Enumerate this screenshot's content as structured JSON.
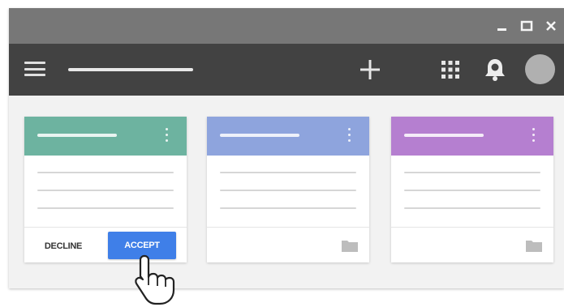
{
  "window": {
    "controls": [
      "minimize-icon",
      "maximize-icon",
      "close-icon"
    ]
  },
  "appbar": {
    "menu_icon": "hamburger-menu-icon",
    "add_icon": "plus-icon",
    "apps_icon": "apps-grid-icon",
    "notifications_icon": "bell-icon",
    "avatar_icon": "account-avatar"
  },
  "cards": [
    {
      "header_color": "#6db3a0",
      "menu_icon": "more-vert-icon",
      "footer": {
        "decline_label": "DECLINE",
        "accept_label": "ACCEPT"
      }
    },
    {
      "header_color": "#8ea4dd",
      "menu_icon": "more-vert-icon",
      "footer": {
        "folder_icon": "folder-icon"
      }
    },
    {
      "header_color": "#b57fd0",
      "menu_icon": "more-vert-icon",
      "footer": {
        "folder_icon": "folder-icon"
      }
    }
  ],
  "colors": {
    "titlebar": "#777777",
    "appbar": "#424242",
    "accent": "#3f7fe8",
    "background": "#f2f2f2"
  },
  "cursor_icon": "hand-pointer-icon"
}
